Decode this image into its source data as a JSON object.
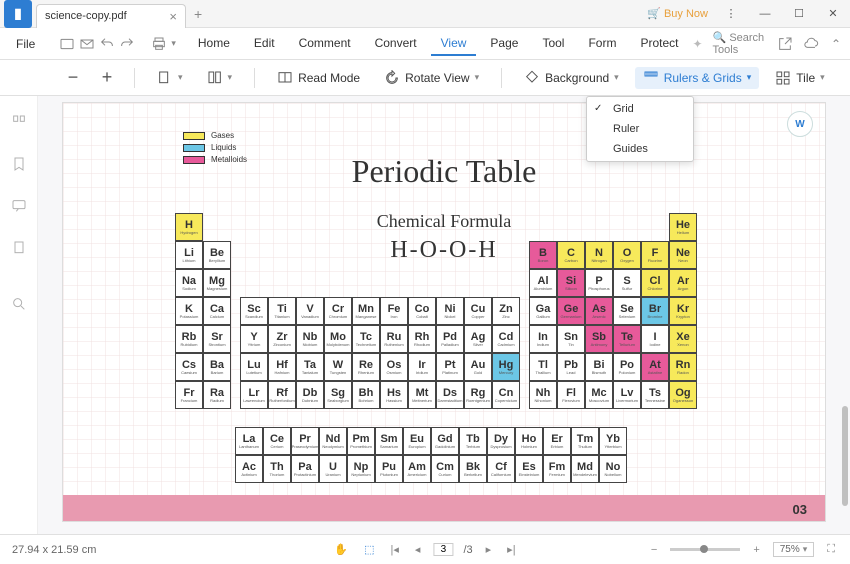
{
  "tab": {
    "filename": "science-copy.pdf"
  },
  "titleRight": {
    "buy": "Buy Now"
  },
  "menubar": {
    "file": "File",
    "items": [
      "Home",
      "Edit",
      "Comment",
      "Convert",
      "View",
      "Page",
      "Tool",
      "Form",
      "Protect"
    ],
    "activeIndex": 4,
    "search": "Search Tools"
  },
  "toolbar": {
    "readMode": "Read Mode",
    "rotate": "Rotate View",
    "background": "Background",
    "rulers": "Rulers & Grids",
    "tile": "Tile"
  },
  "dropdown": {
    "items": [
      "Grid",
      "Ruler",
      "Guides"
    ],
    "checked": 0
  },
  "doc": {
    "title": "Periodic Table",
    "subtitle": "Chemical Formula",
    "formula": "H-O-O-H",
    "pageNum": "03",
    "legend": [
      {
        "label": "Gases",
        "color": "#f7e95b"
      },
      {
        "label": "Liquids",
        "color": "#6cc7e6"
      },
      {
        "label": "Metalloids",
        "color": "#e75a9a"
      }
    ]
  },
  "status": {
    "dims": "27.94 x 21.59 cm",
    "currentPage": "3",
    "totalPages": "/3",
    "zoom": "75%"
  }
}
